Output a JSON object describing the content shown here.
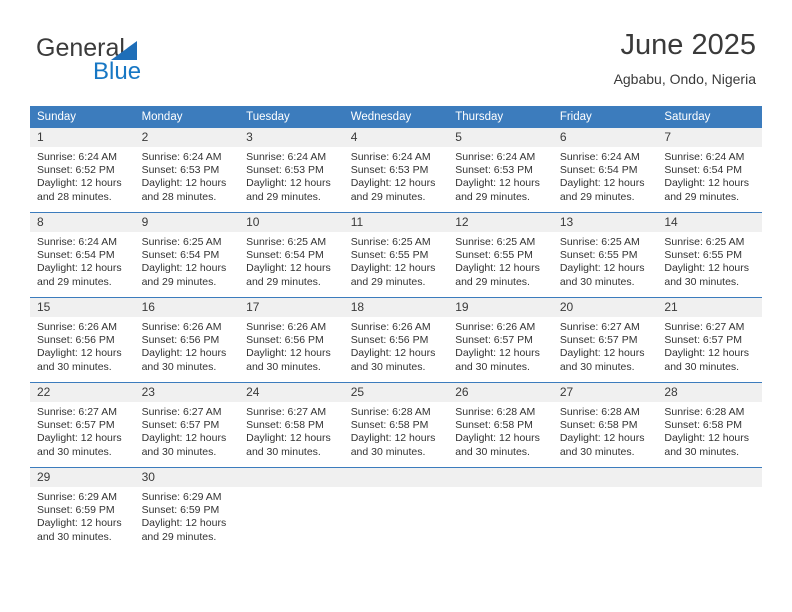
{
  "logo": {
    "word_top": "General",
    "word_bottom": "Blue",
    "triangle_icon": "blue-triangle-icon",
    "color_dark": "#3b3b3b",
    "color_blue": "#1777c4"
  },
  "header": {
    "title": "June 2025",
    "location": "Agbabu, Ondo, Nigeria"
  },
  "theme": {
    "header_bg": "#3c7cbd",
    "header_text": "#ffffff",
    "daynum_bg": "#f0f0f0",
    "separator": "#3c7cbd"
  },
  "weekday_headers": [
    "Sunday",
    "Monday",
    "Tuesday",
    "Wednesday",
    "Thursday",
    "Friday",
    "Saturday"
  ],
  "labels": {
    "sunrise_prefix": "Sunrise:",
    "sunset_prefix": "Sunset:",
    "daylight_prefix": "Daylight:"
  },
  "weeks": [
    {
      "days": [
        {
          "day": "1",
          "sunrise": "Sunrise: 6:24 AM",
          "sunset": "Sunset: 6:52 PM",
          "daylight": "Daylight: 12 hours and 28 minutes."
        },
        {
          "day": "2",
          "sunrise": "Sunrise: 6:24 AM",
          "sunset": "Sunset: 6:53 PM",
          "daylight": "Daylight: 12 hours and 28 minutes."
        },
        {
          "day": "3",
          "sunrise": "Sunrise: 6:24 AM",
          "sunset": "Sunset: 6:53 PM",
          "daylight": "Daylight: 12 hours and 29 minutes."
        },
        {
          "day": "4",
          "sunrise": "Sunrise: 6:24 AM",
          "sunset": "Sunset: 6:53 PM",
          "daylight": "Daylight: 12 hours and 29 minutes."
        },
        {
          "day": "5",
          "sunrise": "Sunrise: 6:24 AM",
          "sunset": "Sunset: 6:53 PM",
          "daylight": "Daylight: 12 hours and 29 minutes."
        },
        {
          "day": "6",
          "sunrise": "Sunrise: 6:24 AM",
          "sunset": "Sunset: 6:54 PM",
          "daylight": "Daylight: 12 hours and 29 minutes."
        },
        {
          "day": "7",
          "sunrise": "Sunrise: 6:24 AM",
          "sunset": "Sunset: 6:54 PM",
          "daylight": "Daylight: 12 hours and 29 minutes."
        }
      ]
    },
    {
      "days": [
        {
          "day": "8",
          "sunrise": "Sunrise: 6:24 AM",
          "sunset": "Sunset: 6:54 PM",
          "daylight": "Daylight: 12 hours and 29 minutes."
        },
        {
          "day": "9",
          "sunrise": "Sunrise: 6:25 AM",
          "sunset": "Sunset: 6:54 PM",
          "daylight": "Daylight: 12 hours and 29 minutes."
        },
        {
          "day": "10",
          "sunrise": "Sunrise: 6:25 AM",
          "sunset": "Sunset: 6:54 PM",
          "daylight": "Daylight: 12 hours and 29 minutes."
        },
        {
          "day": "11",
          "sunrise": "Sunrise: 6:25 AM",
          "sunset": "Sunset: 6:55 PM",
          "daylight": "Daylight: 12 hours and 29 minutes."
        },
        {
          "day": "12",
          "sunrise": "Sunrise: 6:25 AM",
          "sunset": "Sunset: 6:55 PM",
          "daylight": "Daylight: 12 hours and 29 minutes."
        },
        {
          "day": "13",
          "sunrise": "Sunrise: 6:25 AM",
          "sunset": "Sunset: 6:55 PM",
          "daylight": "Daylight: 12 hours and 30 minutes."
        },
        {
          "day": "14",
          "sunrise": "Sunrise: 6:25 AM",
          "sunset": "Sunset: 6:55 PM",
          "daylight": "Daylight: 12 hours and 30 minutes."
        }
      ]
    },
    {
      "days": [
        {
          "day": "15",
          "sunrise": "Sunrise: 6:26 AM",
          "sunset": "Sunset: 6:56 PM",
          "daylight": "Daylight: 12 hours and 30 minutes."
        },
        {
          "day": "16",
          "sunrise": "Sunrise: 6:26 AM",
          "sunset": "Sunset: 6:56 PM",
          "daylight": "Daylight: 12 hours and 30 minutes."
        },
        {
          "day": "17",
          "sunrise": "Sunrise: 6:26 AM",
          "sunset": "Sunset: 6:56 PM",
          "daylight": "Daylight: 12 hours and 30 minutes."
        },
        {
          "day": "18",
          "sunrise": "Sunrise: 6:26 AM",
          "sunset": "Sunset: 6:56 PM",
          "daylight": "Daylight: 12 hours and 30 minutes."
        },
        {
          "day": "19",
          "sunrise": "Sunrise: 6:26 AM",
          "sunset": "Sunset: 6:57 PM",
          "daylight": "Daylight: 12 hours and 30 minutes."
        },
        {
          "day": "20",
          "sunrise": "Sunrise: 6:27 AM",
          "sunset": "Sunset: 6:57 PM",
          "daylight": "Daylight: 12 hours and 30 minutes."
        },
        {
          "day": "21",
          "sunrise": "Sunrise: 6:27 AM",
          "sunset": "Sunset: 6:57 PM",
          "daylight": "Daylight: 12 hours and 30 minutes."
        }
      ]
    },
    {
      "days": [
        {
          "day": "22",
          "sunrise": "Sunrise: 6:27 AM",
          "sunset": "Sunset: 6:57 PM",
          "daylight": "Daylight: 12 hours and 30 minutes."
        },
        {
          "day": "23",
          "sunrise": "Sunrise: 6:27 AM",
          "sunset": "Sunset: 6:57 PM",
          "daylight": "Daylight: 12 hours and 30 minutes."
        },
        {
          "day": "24",
          "sunrise": "Sunrise: 6:27 AM",
          "sunset": "Sunset: 6:58 PM",
          "daylight": "Daylight: 12 hours and 30 minutes."
        },
        {
          "day": "25",
          "sunrise": "Sunrise: 6:28 AM",
          "sunset": "Sunset: 6:58 PM",
          "daylight": "Daylight: 12 hours and 30 minutes."
        },
        {
          "day": "26",
          "sunrise": "Sunrise: 6:28 AM",
          "sunset": "Sunset: 6:58 PM",
          "daylight": "Daylight: 12 hours and 30 minutes."
        },
        {
          "day": "27",
          "sunrise": "Sunrise: 6:28 AM",
          "sunset": "Sunset: 6:58 PM",
          "daylight": "Daylight: 12 hours and 30 minutes."
        },
        {
          "day": "28",
          "sunrise": "Sunrise: 6:28 AM",
          "sunset": "Sunset: 6:58 PM",
          "daylight": "Daylight: 12 hours and 30 minutes."
        }
      ]
    },
    {
      "days": [
        {
          "day": "29",
          "sunrise": "Sunrise: 6:29 AM",
          "sunset": "Sunset: 6:59 PM",
          "daylight": "Daylight: 12 hours and 30 minutes."
        },
        {
          "day": "30",
          "sunrise": "Sunrise: 6:29 AM",
          "sunset": "Sunset: 6:59 PM",
          "daylight": "Daylight: 12 hours and 29 minutes."
        },
        {
          "day": "",
          "sunrise": "",
          "sunset": "",
          "daylight": ""
        },
        {
          "day": "",
          "sunrise": "",
          "sunset": "",
          "daylight": ""
        },
        {
          "day": "",
          "sunrise": "",
          "sunset": "",
          "daylight": ""
        },
        {
          "day": "",
          "sunrise": "",
          "sunset": "",
          "daylight": ""
        },
        {
          "day": "",
          "sunrise": "",
          "sunset": "",
          "daylight": ""
        }
      ]
    }
  ]
}
